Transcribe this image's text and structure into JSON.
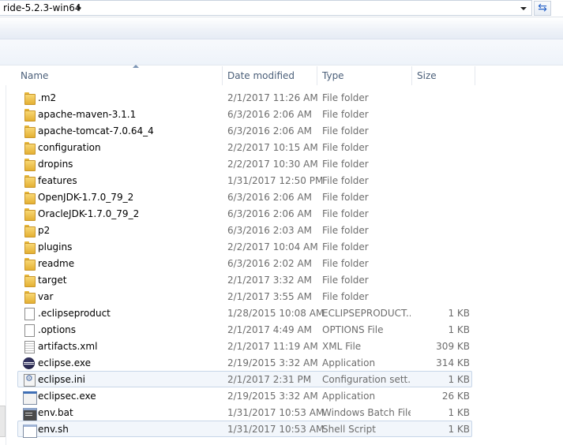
{
  "address_bar": {
    "path": "ride-5.2.3-win64",
    "refresh_icon": "refresh-icon",
    "refresh_glyph": "⇆"
  },
  "columns": {
    "name": "Name",
    "date_modified": "Date modified",
    "type": "Type",
    "size": "Size"
  },
  "files": [
    {
      "name": ".m2",
      "date": "2/1/2017 11:26 AM",
      "type": "File folder",
      "size": "",
      "icon": "folder-icon"
    },
    {
      "name": "apache-maven-3.1.1",
      "date": "6/3/2016 2:06 AM",
      "type": "File folder",
      "size": "",
      "icon": "folder-icon"
    },
    {
      "name": "apache-tomcat-7.0.64_4",
      "date": "6/3/2016 2:06 AM",
      "type": "File folder",
      "size": "",
      "icon": "folder-icon"
    },
    {
      "name": "configuration",
      "date": "2/2/2017 10:15 AM",
      "type": "File folder",
      "size": "",
      "icon": "folder-icon"
    },
    {
      "name": "dropins",
      "date": "2/2/2017 10:30 AM",
      "type": "File folder",
      "size": "",
      "icon": "folder-icon"
    },
    {
      "name": "features",
      "date": "1/31/2017 12:50 PM",
      "type": "File folder",
      "size": "",
      "icon": "folder-icon"
    },
    {
      "name": "OpenJDK-1.7.0_79_2",
      "date": "6/3/2016 2:06 AM",
      "type": "File folder",
      "size": "",
      "icon": "folder-icon"
    },
    {
      "name": "OracleJDK-1.7.0_79_2",
      "date": "6/3/2016 2:06 AM",
      "type": "File folder",
      "size": "",
      "icon": "folder-icon"
    },
    {
      "name": "p2",
      "date": "6/3/2016 2:03 AM",
      "type": "File folder",
      "size": "",
      "icon": "folder-icon"
    },
    {
      "name": "plugins",
      "date": "2/2/2017 10:04 AM",
      "type": "File folder",
      "size": "",
      "icon": "folder-icon"
    },
    {
      "name": "readme",
      "date": "6/3/2016 2:02 AM",
      "type": "File folder",
      "size": "",
      "icon": "folder-icon"
    },
    {
      "name": "target",
      "date": "2/1/2017 3:32 AM",
      "type": "File folder",
      "size": "",
      "icon": "folder-icon"
    },
    {
      "name": "var",
      "date": "2/1/2017 3:55 AM",
      "type": "File folder",
      "size": "",
      "icon": "folder-icon"
    },
    {
      "name": ".eclipseproduct",
      "date": "1/28/2015 10:08 AM",
      "type": "ECLIPSEPRODUCT...",
      "size": "1 KB",
      "icon": "document-icon"
    },
    {
      "name": ".options",
      "date": "2/1/2017 4:49 AM",
      "type": "OPTIONS File",
      "size": "1 KB",
      "icon": "document-icon"
    },
    {
      "name": "artifacts.xml",
      "date": "2/1/2017 11:19 AM",
      "type": "XML File",
      "size": "309 KB",
      "icon": "xml-document-icon"
    },
    {
      "name": "eclipse.exe",
      "date": "2/19/2015 3:32 AM",
      "type": "Application",
      "size": "314 KB",
      "icon": "eclipse-icon"
    },
    {
      "name": "eclipse.ini",
      "date": "2/1/2017 2:31 PM",
      "type": "Configuration sett...",
      "size": "1 KB",
      "icon": "config-file-icon",
      "selected": true
    },
    {
      "name": "eclipsec.exe",
      "date": "2/19/2015 3:32 AM",
      "type": "Application",
      "size": "26 KB",
      "icon": "application-window-icon"
    },
    {
      "name": "env.bat",
      "date": "1/31/2017 10:53 AM",
      "type": "Windows Batch File",
      "size": "1 KB",
      "icon": "batch-file-icon"
    },
    {
      "name": "env.sh",
      "date": "1/31/2017 10:53 AM",
      "type": "Shell Script",
      "size": "1 KB",
      "icon": "shell-script-icon",
      "selected": true
    }
  ]
}
